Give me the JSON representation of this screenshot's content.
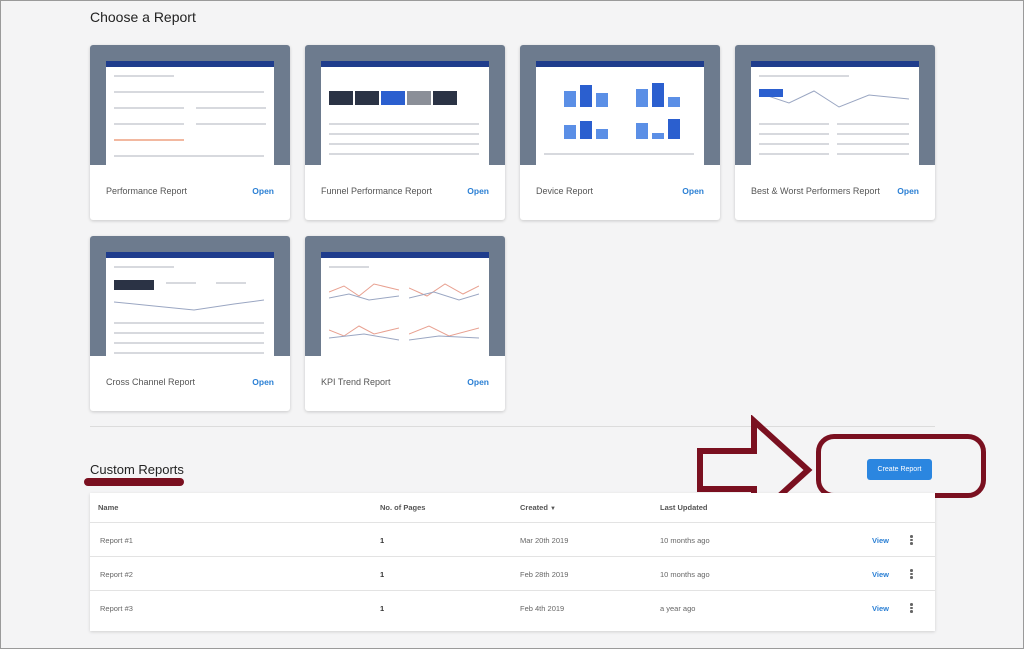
{
  "header": {
    "choose_title": "Choose a Report"
  },
  "reports": [
    {
      "label": "Performance Report",
      "open": "Open"
    },
    {
      "label": "Funnel Performance Report",
      "open": "Open"
    },
    {
      "label": "Device Report",
      "open": "Open"
    },
    {
      "label": "Best & Worst Performers Report",
      "open": "Open"
    },
    {
      "label": "Cross Channel Report",
      "open": "Open"
    },
    {
      "label": "KPI Trend Report",
      "open": "Open"
    }
  ],
  "custom": {
    "title": "Custom Reports",
    "create_label": "Create Report",
    "columns": [
      "Name",
      "No. of Pages",
      "Created",
      "Last Updated"
    ],
    "sort_icon": "caret-down",
    "rows": [
      {
        "name": "Report #1",
        "pages": "1",
        "created": "Mar 20th 2019",
        "updated": "10 months ago",
        "action": "View"
      },
      {
        "name": "Report #2",
        "pages": "1",
        "created": "Feb 28th 2019",
        "updated": "10 months ago",
        "action": "View"
      },
      {
        "name": "Report #3",
        "pages": "1",
        "created": "Feb 4th 2019",
        "updated": "a year ago",
        "action": "View"
      }
    ]
  },
  "colors": {
    "accent": "#2b86e0",
    "annotation": "#7a1020",
    "thumb_bg": "#6d7b8e"
  }
}
